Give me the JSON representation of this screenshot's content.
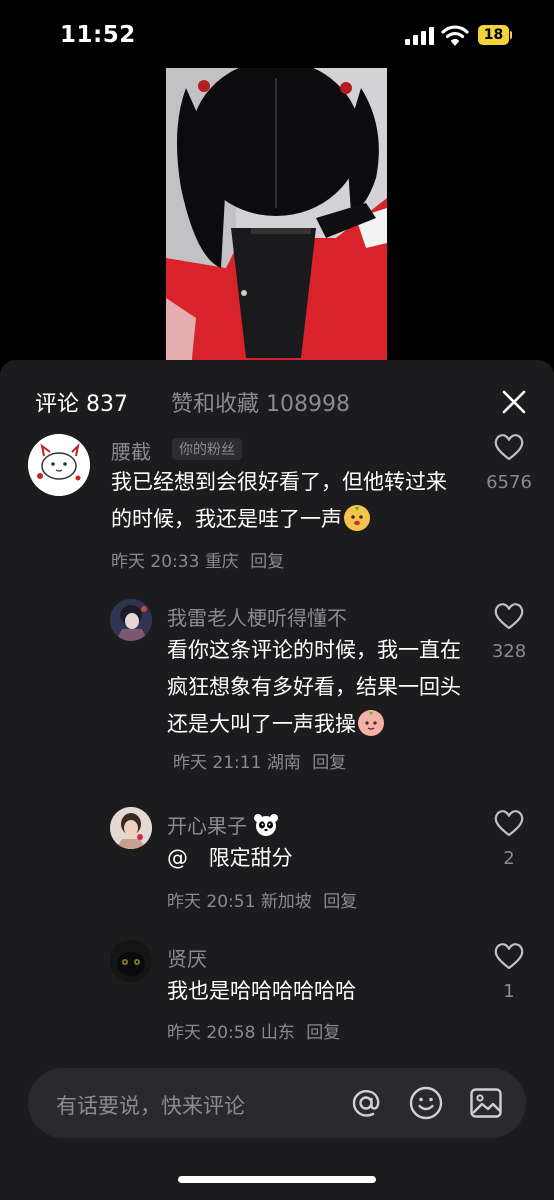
{
  "status_bar": {
    "time": "11:52",
    "battery": "18"
  },
  "panel": {
    "comments_tab": "评论 837",
    "likes_tab": "赞和收藏 108998",
    "close_icon": "close-icon"
  },
  "comments": [
    {
      "username": "腰截",
      "badge": "你的粉丝",
      "text": "我已经想到会很好看了，但他转过来的时候，我还是哇了一声",
      "time": "昨天 20:33",
      "location": "重庆",
      "reply": "回复",
      "likes": "6576"
    },
    {
      "username": "我雷老人梗听得懂不",
      "text": "看你这条评论的时候，我一直在疯狂想象有多好看，结果一回头还是大叫了一声我操",
      "time": "昨天 21:11",
      "location": "湖南",
      "reply": "回复",
      "likes": "328"
    },
    {
      "username": "开心果子",
      "mention_at": "@",
      "mention": "限定甜分",
      "time": "昨天 20:51",
      "location": "新加坡",
      "reply": "回复",
      "likes": "2"
    },
    {
      "username": "贤厌",
      "text": "我也是哈哈哈哈哈哈",
      "time": "昨天 20:58",
      "location": "山东",
      "reply": "回复",
      "likes": "1"
    }
  ],
  "input": {
    "placeholder": "有话要说，快来评论",
    "icons": [
      "at-icon",
      "emoji-icon",
      "image-icon"
    ]
  },
  "colors": {
    "panel_bg": "#1c1c1f",
    "muted_text": "#8a8a8f",
    "battery": "#f4d23c"
  }
}
